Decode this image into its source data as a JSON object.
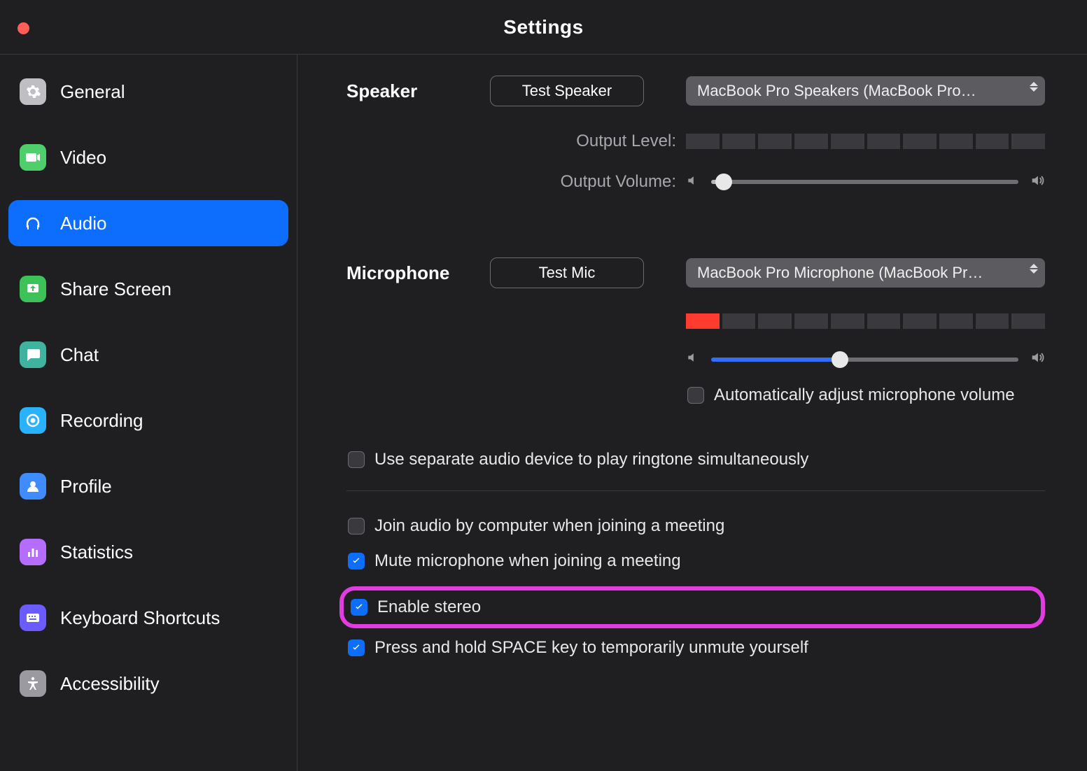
{
  "window": {
    "title": "Settings"
  },
  "sidebar": {
    "items": [
      {
        "label": "General"
      },
      {
        "label": "Video"
      },
      {
        "label": "Audio"
      },
      {
        "label": "Share Screen"
      },
      {
        "label": "Chat"
      },
      {
        "label": "Recording"
      },
      {
        "label": "Profile"
      },
      {
        "label": "Statistics"
      },
      {
        "label": "Keyboard Shortcuts"
      },
      {
        "label": "Accessibility"
      }
    ],
    "active_index": 2
  },
  "speaker": {
    "section": "Speaker",
    "test_button": "Test Speaker",
    "device": "MacBook Pro Speakers (MacBook Pro…",
    "output_level_label": "Output Level:",
    "output_level_segments_on": 0,
    "output_volume_label": "Output Volume:",
    "output_volume_pct": 4
  },
  "microphone": {
    "section": "Microphone",
    "test_button": "Test Mic",
    "device": "MacBook Pro Microphone (MacBook Pr…",
    "input_level_segments_on": 1,
    "input_volume_pct": 42,
    "auto_adjust": {
      "label": "Automatically adjust microphone volume",
      "checked": false
    }
  },
  "options": {
    "separate_ringtone": {
      "label": "Use separate audio device to play ringtone simultaneously",
      "checked": false
    },
    "join_audio": {
      "label": "Join audio by computer when joining a meeting",
      "checked": false
    },
    "mute_on_join": {
      "label": "Mute microphone when joining a meeting",
      "checked": true
    },
    "enable_stereo": {
      "label": "Enable stereo",
      "checked": true
    },
    "press_hold_space": {
      "label": "Press and hold SPACE key to temporarily unmute yourself",
      "checked": true
    }
  }
}
